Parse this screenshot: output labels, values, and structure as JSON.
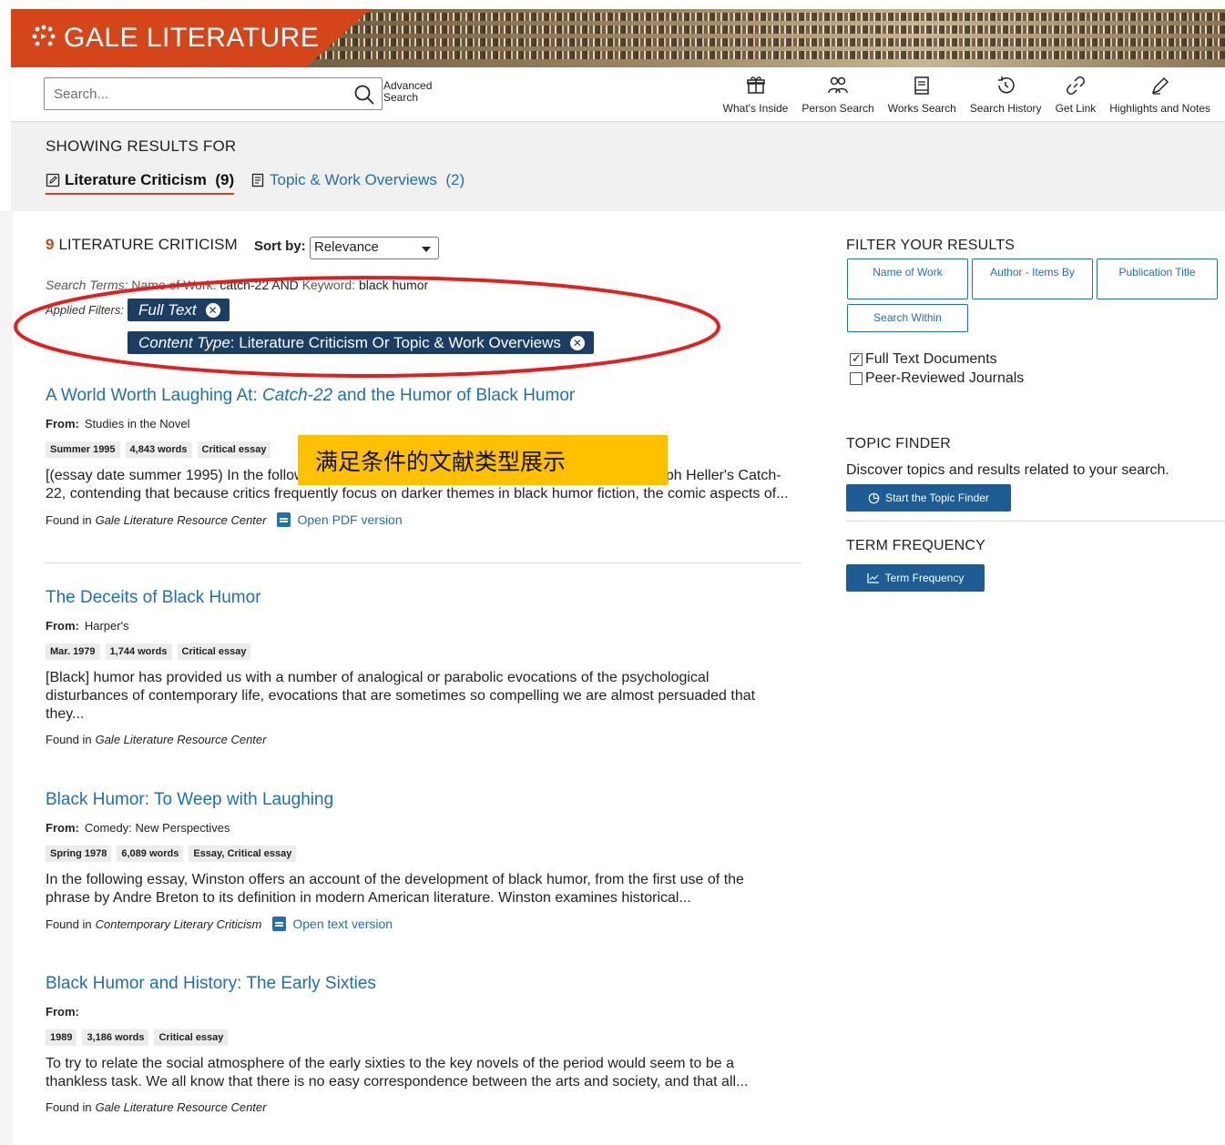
{
  "brand": {
    "logo_text": "GALE LITERATURE"
  },
  "search": {
    "placeholder": "Search...",
    "advanced_line1": "Advanced",
    "advanced_line2": "Search"
  },
  "tools": [
    {
      "label": "What's Inside",
      "icon": "gift-icon"
    },
    {
      "label": "Person Search",
      "icon": "people-icon"
    },
    {
      "label": "Works Search",
      "icon": "book-icon"
    },
    {
      "label": "Search History",
      "icon": "history-icon"
    },
    {
      "label": "Get Link",
      "icon": "link-icon"
    },
    {
      "label": "Highlights and Notes",
      "icon": "pen-icon"
    }
  ],
  "results_for": {
    "heading": "SHOWING RESULTS FOR",
    "tab_active": "Literature Criticism  (9)",
    "tab_other": "Topic & Work Overviews  (2)"
  },
  "listing": {
    "count": "9",
    "count_label": "LITERATURE CRITICISM",
    "sort_label": "Sort by:",
    "sort_value": "Relevance",
    "search_terms_label": "Search Terms:",
    "search_terms_name_key": "Name of Work:",
    "search_terms_name_val": "catch-22",
    "search_terms_and": "AND",
    "search_terms_kw_key": "Keyword:",
    "search_terms_kw_val": "black humor",
    "applied_label": "Applied Filters:",
    "chip1": "Full Text",
    "chip2_key": "Content Type",
    "chip2_val": ": Literature Criticism Or Topic & Work Overviews"
  },
  "annotation": {
    "note": "满足条件的文献类型展示"
  },
  "results": [
    {
      "title_pre": "A World Worth Laughing At: ",
      "title_em": "Catch-22",
      "title_post": " and the Humor of Black Humor",
      "from_label": "From:",
      "from": "Studies in the Novel",
      "badges": [
        "Summer 1995",
        "4,843 words",
        "Critical essay"
      ],
      "snippet": "[(essay date summer 1995) In the following essay, the critic examines the comic aspects of Joseph Heller's Catch-22, contending that because critics frequently focus on darker themes in black humor fiction, the comic aspects of...",
      "found_label": "Found in",
      "found_source": "Gale Literature Resource Center",
      "open_link": "Open PDF version"
    },
    {
      "title": "The Deceits of Black Humor",
      "from_label": "From:",
      "from": "Harper's",
      "badges": [
        "Mar. 1979",
        "1,744 words",
        "Critical essay"
      ],
      "snippet": "[Black] humor has provided us with a number of analogical or parabolic evocations of the psychological disturbances of contemporary life, evocations that are sometimes so compelling we are almost persuaded that they...",
      "found_label": "Found in",
      "found_source": "Gale Literature Resource Center"
    },
    {
      "title": "Black Humor: To Weep with Laughing",
      "from_label": "From:",
      "from": "Comedy: New Perspectives",
      "badges": [
        "Spring 1978",
        "6,089 words",
        "Essay, Critical essay"
      ],
      "snippet": "In the following essay, Winston offers an account of the development of black humor, from the first use of the phrase by Andre Breton to its definition in modern American literature. Winston examines historical...",
      "found_label": "Found in",
      "found_source": "Contemporary Literary Criticism",
      "open_link": "Open text version"
    },
    {
      "title": "Black Humor and History: The Early Sixties",
      "from_label": "From:",
      "from": "",
      "badges": [
        "1989",
        "3,186 words",
        "Critical essay"
      ],
      "snippet": "To try to relate the social atmosphere of the early sixties to the key novels of the period would seem to be a thankless task. We all know that there is no easy correspondence between the arts and society, and that all...",
      "found_label": "Found in",
      "found_source": "Gale Literature Resource Center"
    }
  ],
  "filters": {
    "title": "FILTER YOUR RESULTS",
    "buttons": [
      "Name of Work",
      "Author - Items By",
      "Publication Title",
      "Search Within"
    ],
    "checks": [
      {
        "label": "Full Text Documents",
        "checked": true
      },
      {
        "label": "Peer-Reviewed Journals",
        "checked": false
      }
    ],
    "topic_finder_title": "TOPIC FINDER",
    "topic_finder_text": "Discover topics and results related to your search.",
    "topic_finder_button": "Start the Topic Finder",
    "term_freq_title": "TERM FREQUENCY",
    "term_freq_button": "Term Frequency"
  },
  "colors": {
    "brand_orange": "#d4461a",
    "link_blue": "#1f6fb2",
    "chip_navy": "#1d3e63",
    "annotation_red": "#e41f1f",
    "annotation_yellow": "#ffc000"
  }
}
